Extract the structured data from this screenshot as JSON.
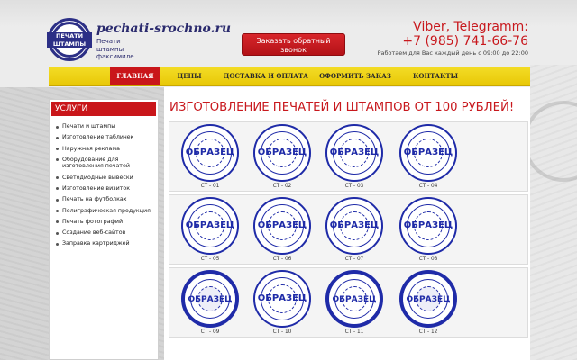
{
  "header": {
    "logo": {
      "seal_line1": "ПЕЧАТИ",
      "seal_line2": "и",
      "seal_line3": "ШТАМПЫ",
      "site": "pechati-srochno.ru",
      "sub": [
        "Печати",
        "штампы",
        "факсимиле"
      ]
    },
    "callback_label": "Заказать обратный звонок",
    "messengers": "Viber, Telegramm:",
    "phone": "+7 (985) 741-66-76",
    "hours": "Работаем для Вас каждый день с 09:00 до 22:00"
  },
  "nav": {
    "items": [
      {
        "label": "ГЛАВНАЯ"
      },
      {
        "label": "ЦЕНЫ"
      },
      {
        "label": "ДОСТАВКА И ОПЛАТА"
      },
      {
        "label": "ОФОРМИТЬ ЗАКАЗ"
      },
      {
        "label": "КОНТАКТЫ"
      }
    ]
  },
  "sidebar": {
    "title": "УСЛУГИ",
    "items": [
      "Печати и штампы",
      "Изготовление табличек",
      "Наружная реклама",
      "Оборудование для изготовления печатей",
      "Светодиодные вывески",
      "Изготовление визиток",
      "Печать на футболках",
      "Полиграфическая продукция",
      "Печать фотографий",
      "Создание веб-сайтов",
      "Заправка картриджей"
    ]
  },
  "main": {
    "title": "ИЗГОТОВЛЕНИЕ ПЕЧАТЕЙ И ШТАМПОВ ОТ 100 РУБЛЕЙ!",
    "sample_text": "ОБРАЗЕЦ",
    "stamps": [
      "СТ - 01",
      "СТ - 02",
      "СТ - 03",
      "СТ - 04",
      "СТ - 05",
      "СТ - 06",
      "СТ - 07",
      "СТ - 08",
      "СТ - 09",
      "СТ - 10",
      "СТ - 11",
      "СТ - 12"
    ]
  },
  "colors": {
    "accent_red": "#c8181d",
    "nav_yellow": "#f3dc25",
    "stamp_blue": "#1f2ba8"
  }
}
